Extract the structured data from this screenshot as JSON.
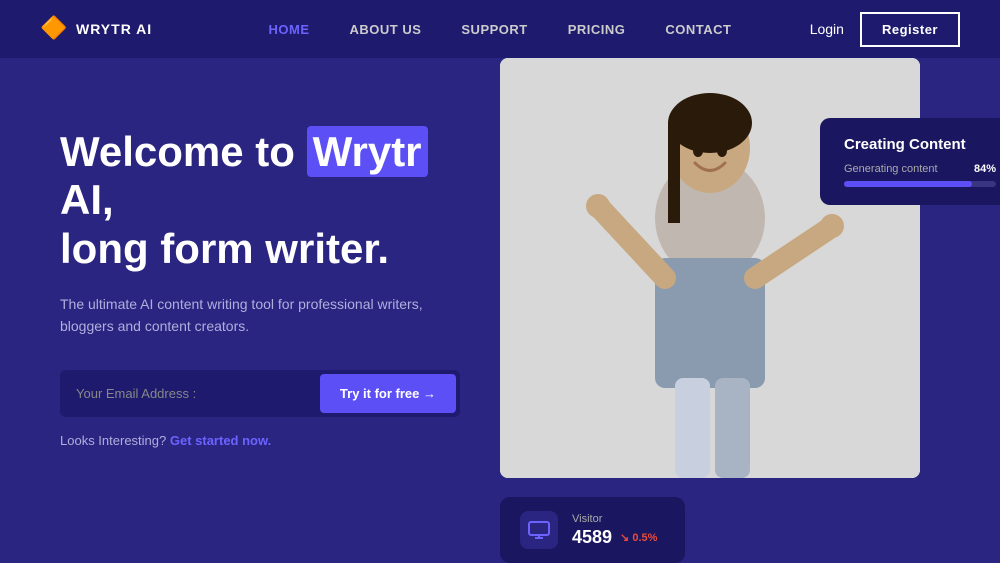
{
  "brand": {
    "name": "WRYTR AI",
    "logo_icon": "🔶"
  },
  "nav": {
    "links": [
      {
        "label": "HOME",
        "active": true
      },
      {
        "label": "ABOUT US",
        "active": false
      },
      {
        "label": "SUPPORT",
        "active": false
      },
      {
        "label": "PRICING",
        "active": false
      },
      {
        "label": "CONTACT",
        "active": false
      }
    ],
    "login_label": "Login",
    "register_label": "Register"
  },
  "hero": {
    "title_before": "Welcome to",
    "title_highlight": "Wrytr",
    "title_after": "AI,",
    "title_line2": "long form writer.",
    "subtitle": "The ultimate AI content writing tool for professional writers, bloggers and content creators.",
    "email_placeholder": "Your Email Address :",
    "cta_label": "Try it for free →",
    "looks_interesting": "Looks Interesting?",
    "get_started": "Get started now."
  },
  "creating_content_card": {
    "title": "Creating Content",
    "label": "Generating content",
    "percent": "84%",
    "progress": 84
  },
  "visitor_card": {
    "label": "Visitor",
    "count": "4589",
    "change": "↘ 0.5%"
  },
  "colors": {
    "bg_dark": "#1e1a6e",
    "bg_main": "#2a2580",
    "accent": "#5b4ff5",
    "accent_light": "#6c63ff",
    "text_muted": "#b0aedd",
    "card_bg": "#1a1660"
  }
}
